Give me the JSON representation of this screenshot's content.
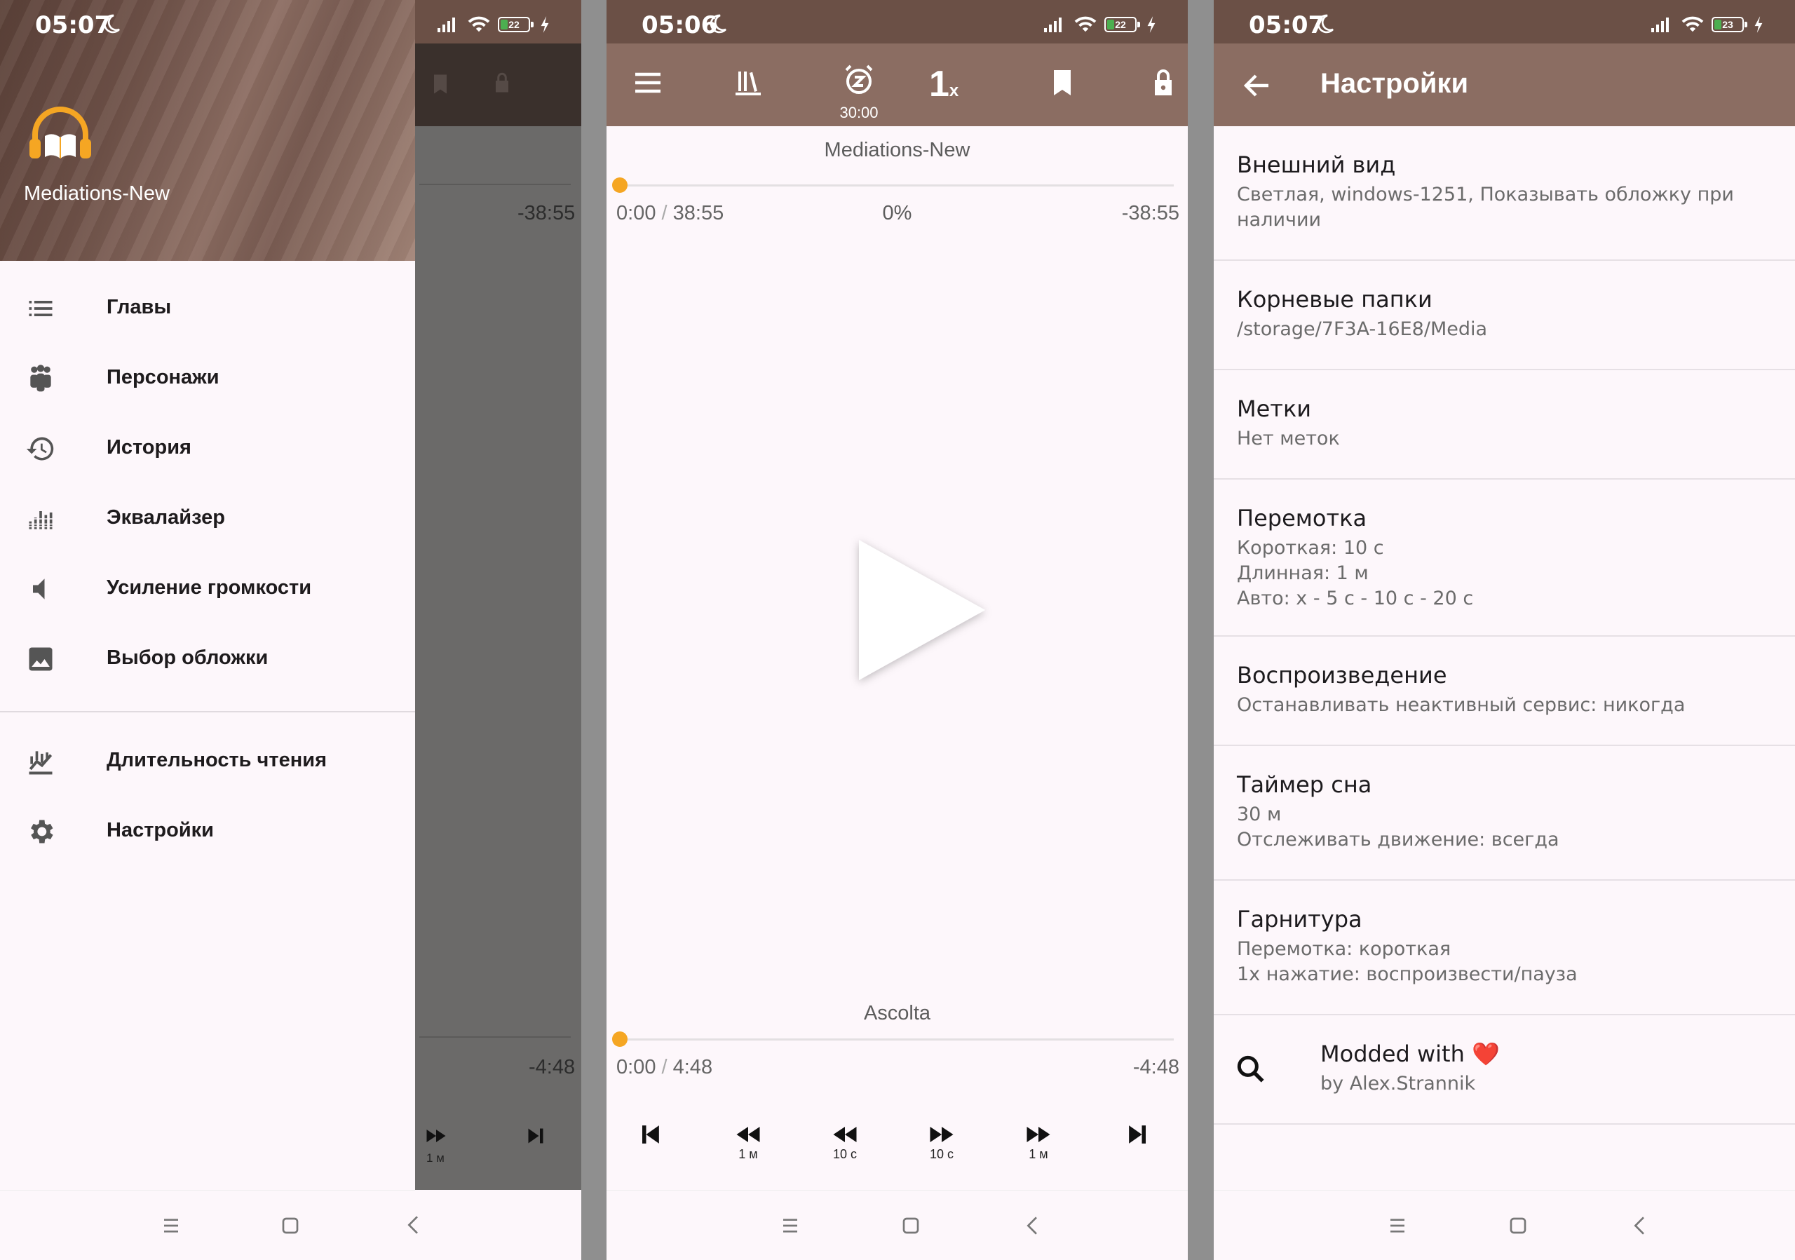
{
  "status_bars": [
    {
      "time": "05:07",
      "battery": "22"
    },
    {
      "time": "05:06",
      "battery": "22"
    },
    {
      "time": "05:07",
      "battery": "23"
    }
  ],
  "drawer": {
    "title": "Mediations-New",
    "items": [
      {
        "label": "Главы"
      },
      {
        "label": "Персонажи"
      },
      {
        "label": "История"
      },
      {
        "label": "Эквалайзер"
      },
      {
        "label": "Усиление громкости"
      },
      {
        "label": "Выбор обложки"
      },
      {
        "label": "Длительность чтения"
      },
      {
        "label": "Настройки"
      }
    ],
    "behind": {
      "remaining_book": "-38:55",
      "remaining_track": "-4:48",
      "skip_1m": "1 м"
    }
  },
  "player": {
    "sleep_timer": "30:00",
    "speed": "1",
    "speed_suffix": "x",
    "book": {
      "title": "Mediations-New",
      "elapsed": "0:00",
      "total": "38:55",
      "percent": "0%",
      "remaining": "-38:55",
      "progress": 0
    },
    "track": {
      "title": "Ascolta",
      "elapsed": "0:00",
      "total": "4:48",
      "remaining": "-4:48",
      "progress": 0
    },
    "controls": [
      {
        "name": "previous",
        "label": ""
      },
      {
        "name": "rewind-long",
        "label": "1 м"
      },
      {
        "name": "rewind-short",
        "label": "10 с"
      },
      {
        "name": "forward-short",
        "label": "10 с"
      },
      {
        "name": "forward-long",
        "label": "1 м"
      },
      {
        "name": "next",
        "label": ""
      }
    ]
  },
  "settings": {
    "title": "Настройки",
    "items": [
      {
        "title": "Внешний вид",
        "desc": "Светлая, windows-1251, Показывать обложку при наличии"
      },
      {
        "title": "Корневые папки",
        "desc": "/storage/7F3A-16E8/Media"
      },
      {
        "title": "Метки",
        "desc": "Нет меток"
      },
      {
        "title": "Перемотка",
        "desc1": "Короткая: 10 с",
        "desc2": "Длинная: 1 м",
        "desc3": "Авто: x - 5 с - 10 с - 20 с"
      },
      {
        "title": "Воспроизведение",
        "desc": "Останавливать неактивный сервис: никогда"
      },
      {
        "title": "Таймер сна",
        "desc1": "30 м",
        "desc2": "Отслеживать движение: всегда"
      },
      {
        "title": "Гарнитура",
        "desc1": "Перемотка: короткая",
        "desc2": "1x нажатие: воспроизвести/пауза"
      },
      {
        "title": "Modded with",
        "heart": "❤️",
        "desc": "by Alex.Strannik"
      }
    ]
  },
  "colors": {
    "toolbar": "#8b6d62",
    "statusbar": "#6b5046",
    "accent": "#f5a623",
    "background": "#fdf7fb"
  }
}
